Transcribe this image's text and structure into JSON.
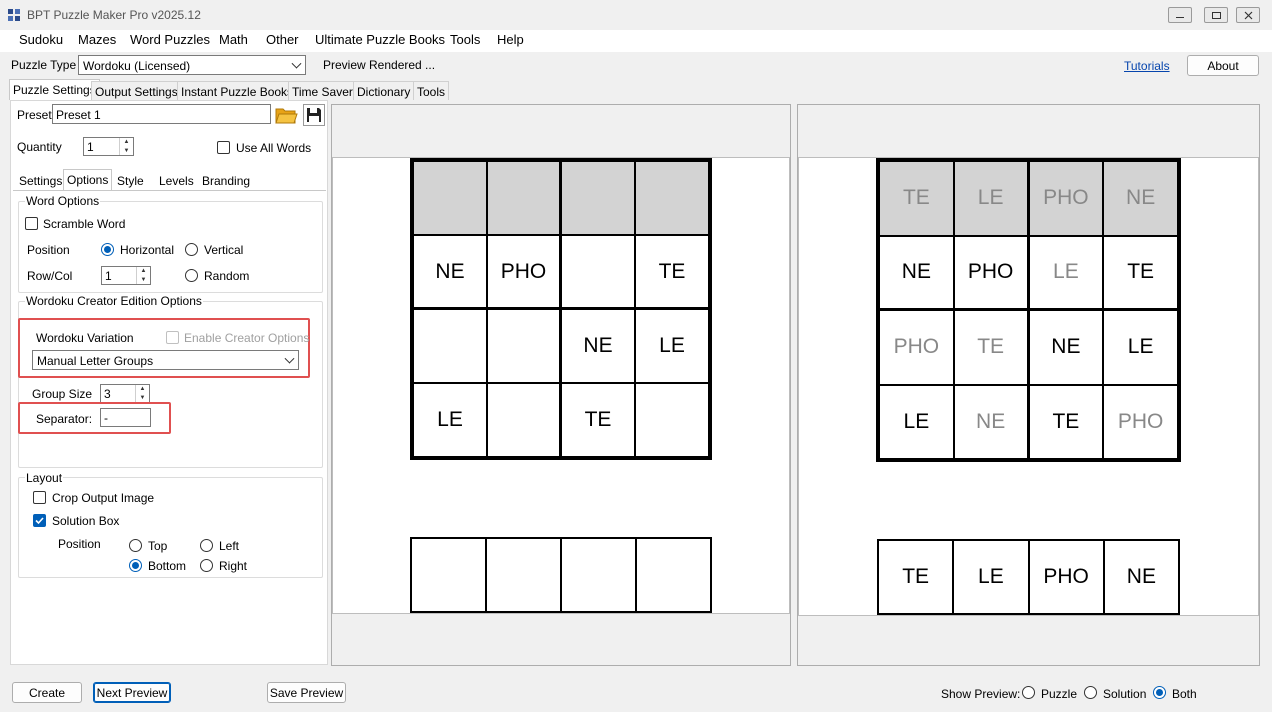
{
  "window": {
    "title": "BPT Puzzle Maker Pro v2025.12"
  },
  "menu": [
    "Sudoku",
    "Mazes",
    "Word Puzzles",
    "Math",
    "Other",
    "Ultimate Puzzle Books",
    "Tools",
    "Help"
  ],
  "toolbar": {
    "puzzle_type_label": "Puzzle Type",
    "puzzle_type_value": "Wordoku (Licensed)",
    "status": "Preview Rendered ...",
    "tutorials_link": "Tutorials",
    "about_button": "About"
  },
  "main_tabs": [
    "Puzzle Settings",
    "Output Settings",
    "Instant Puzzle Books",
    "Time Saver",
    "Dictionary",
    "Tools"
  ],
  "preset": {
    "label": "Preset",
    "value": "Preset 1"
  },
  "quantity": {
    "label": "Quantity",
    "value": "1"
  },
  "use_all_words": {
    "label": "Use All Words",
    "checked": false
  },
  "sub_tabs": [
    "Settings",
    "Options",
    "Style",
    "Levels",
    "Branding"
  ],
  "word_options": {
    "title": "Word Options",
    "scramble_label": "Scramble Word",
    "position_label": "Position",
    "horizontal_label": "Horizontal",
    "vertical_label": "Vertical",
    "rowcol_label": "Row/Col",
    "rowcol_value": "1",
    "random_label": "Random"
  },
  "creator_options": {
    "title": "Wordoku Creator Edition Options",
    "variation_label": "Wordoku Variation",
    "enable_label": "Enable Creator Options",
    "variation_value": "Manual Letter Groups",
    "group_size_label": "Group Size",
    "group_size_value": "3",
    "separator_label": "Separator:",
    "separator_value": "-"
  },
  "layout": {
    "title": "Layout",
    "crop_label": "Crop Output Image",
    "solution_box_label": "Solution Box",
    "position_label": "Position",
    "top_label": "Top",
    "left_label": "Left",
    "bottom_label": "Bottom",
    "right_label": "Right"
  },
  "puzzle_grid": [
    [
      "",
      "",
      "",
      ""
    ],
    [
      "NE",
      "PHO",
      "",
      "TE"
    ],
    [
      "",
      "",
      "NE",
      "LE"
    ],
    [
      "LE",
      "",
      "TE",
      ""
    ]
  ],
  "puzzle_solution_box": [
    "",
    "",
    "",
    ""
  ],
  "solution_grid": [
    [
      "TE",
      "LE",
      "PHO",
      "NE"
    ],
    [
      "NE",
      "PHO",
      "LE",
      "TE"
    ],
    [
      "PHO",
      "TE",
      "NE",
      "LE"
    ],
    [
      "LE",
      "NE",
      "TE",
      "PHO"
    ]
  ],
  "solution_given_mask": [
    [
      false,
      false,
      false,
      false
    ],
    [
      true,
      true,
      false,
      true
    ],
    [
      false,
      false,
      true,
      true
    ],
    [
      true,
      false,
      true,
      false
    ]
  ],
  "solution_box": [
    "TE",
    "LE",
    "PHO",
    "NE"
  ],
  "bottom": {
    "create_button": "Create",
    "next_preview_button": "Next Preview",
    "save_preview_button": "Save Preview",
    "show_preview_label": "Show Preview:",
    "puzzle_label": "Puzzle",
    "solution_label": "Solution",
    "both_label": "Both"
  },
  "colors": {
    "accent": "#005fb8",
    "highlight": "#e05050",
    "shade": "#d3d3d3",
    "link": "#0645ad"
  }
}
